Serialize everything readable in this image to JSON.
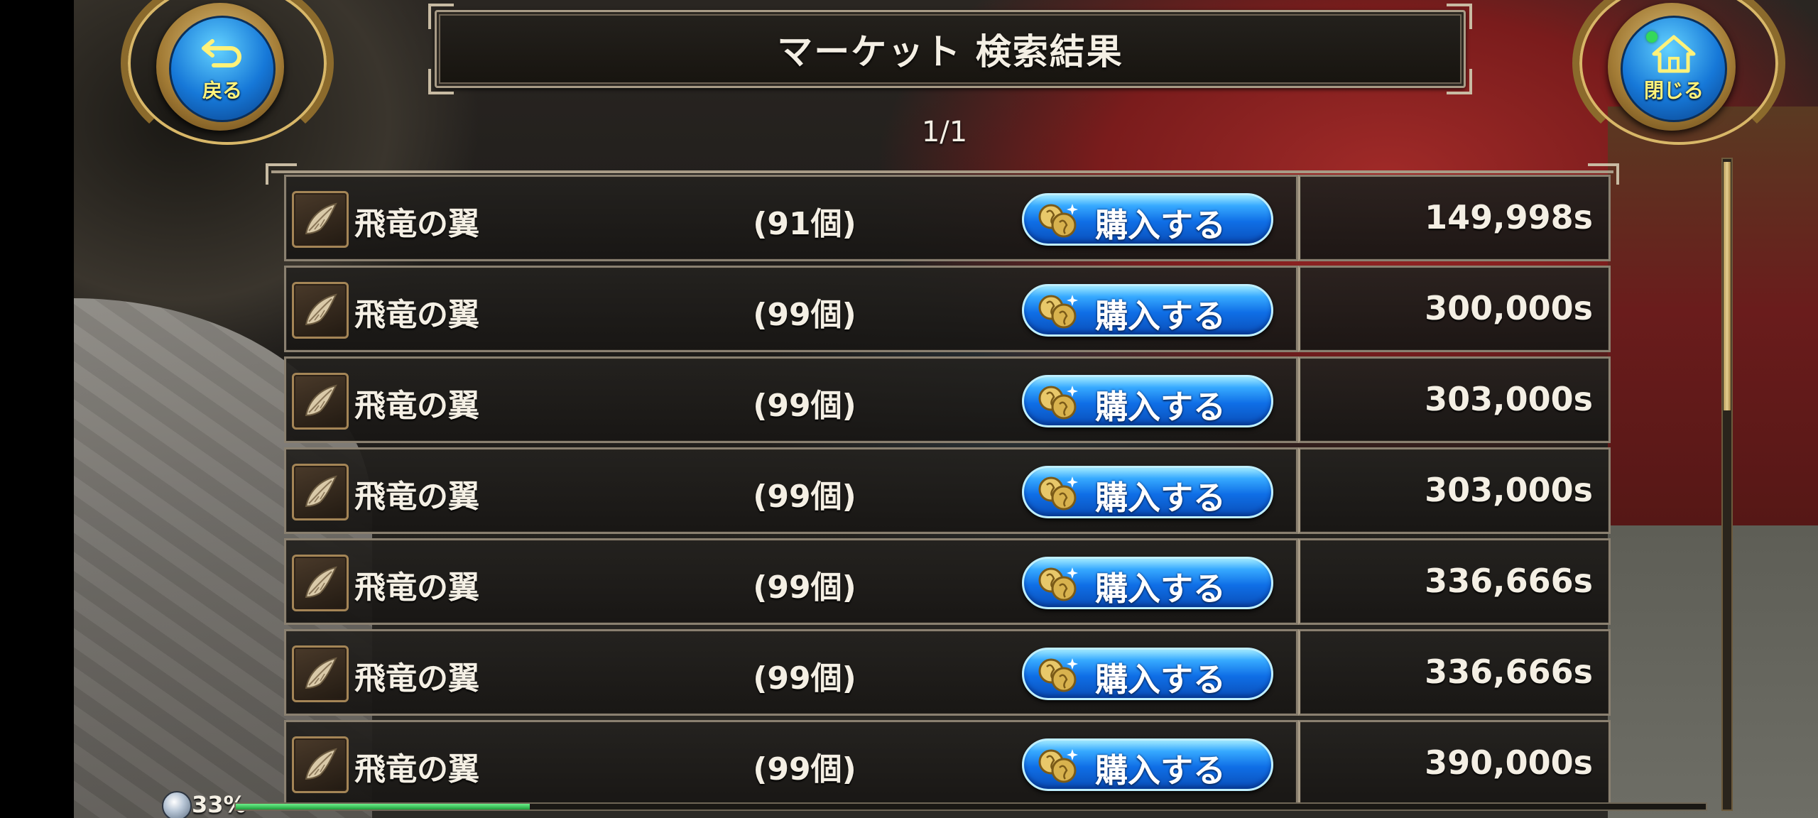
{
  "header": {
    "title": "マーケット 検索結果",
    "page_indicator": "1/1"
  },
  "nav": {
    "back": {
      "label": "戻る",
      "icon": "return-arrow-icon"
    },
    "close": {
      "label": "閉じる",
      "icon": "home-icon"
    }
  },
  "listings": [
    {
      "name": "飛竜の翼",
      "quantity": "(91個)",
      "buy_label": "購入する",
      "price": "149,998s"
    },
    {
      "name": "飛竜の翼",
      "quantity": "(99個)",
      "buy_label": "購入する",
      "price": "300,000s"
    },
    {
      "name": "飛竜の翼",
      "quantity": "(99個)",
      "buy_label": "購入する",
      "price": "303,000s"
    },
    {
      "name": "飛竜の翼",
      "quantity": "(99個)",
      "buy_label": "購入する",
      "price": "303,000s"
    },
    {
      "name": "飛竜の翼",
      "quantity": "(99個)",
      "buy_label": "購入する",
      "price": "336,666s"
    },
    {
      "name": "飛竜の翼",
      "quantity": "(99個)",
      "buy_label": "購入する",
      "price": "336,666s"
    },
    {
      "name": "飛竜の翼",
      "quantity": "(99個)",
      "buy_label": "購入する",
      "price": "390,000s"
    }
  ],
  "item_icon": "wing-feather-icon",
  "buy_icon": "coins-icon",
  "experience": {
    "percent_label": "33%",
    "fraction": 0.2
  },
  "colors": {
    "button_blue": "#1678d8",
    "label_yellow": "#fff27a",
    "frame_gold": "#a89b86",
    "xp_green": "#1f9e3c"
  }
}
